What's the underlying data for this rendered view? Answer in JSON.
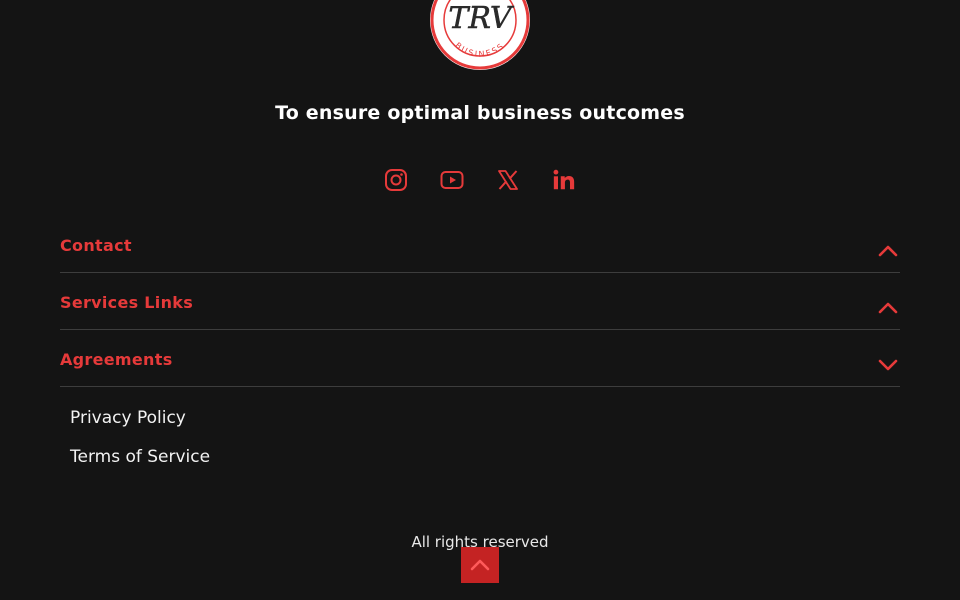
{
  "brand": {
    "logo_text": "TRV",
    "logo_subtext": "BUSINESS",
    "accent_color": "#e63a3a"
  },
  "tagline": "To ensure optimal business outcomes",
  "socials": [
    {
      "icon": "instagram-icon"
    },
    {
      "icon": "youtube-icon"
    },
    {
      "icon": "x-twitter-icon"
    },
    {
      "icon": "linkedin-icon"
    }
  ],
  "accordion": [
    {
      "title": "Contact",
      "state": "collapsed",
      "chevron": "chevron-up-icon"
    },
    {
      "title": "Services Links",
      "state": "collapsed",
      "chevron": "chevron-up-icon"
    },
    {
      "title": "Agreements",
      "state": "expanded",
      "chevron": "chevron-down-icon"
    }
  ],
  "agreement_links": [
    {
      "label": "Privacy Policy"
    },
    {
      "label": "Terms of Service"
    }
  ],
  "footer": {
    "rights": "All rights reserved"
  },
  "back_to_top": {
    "icon": "chevron-up-icon"
  }
}
